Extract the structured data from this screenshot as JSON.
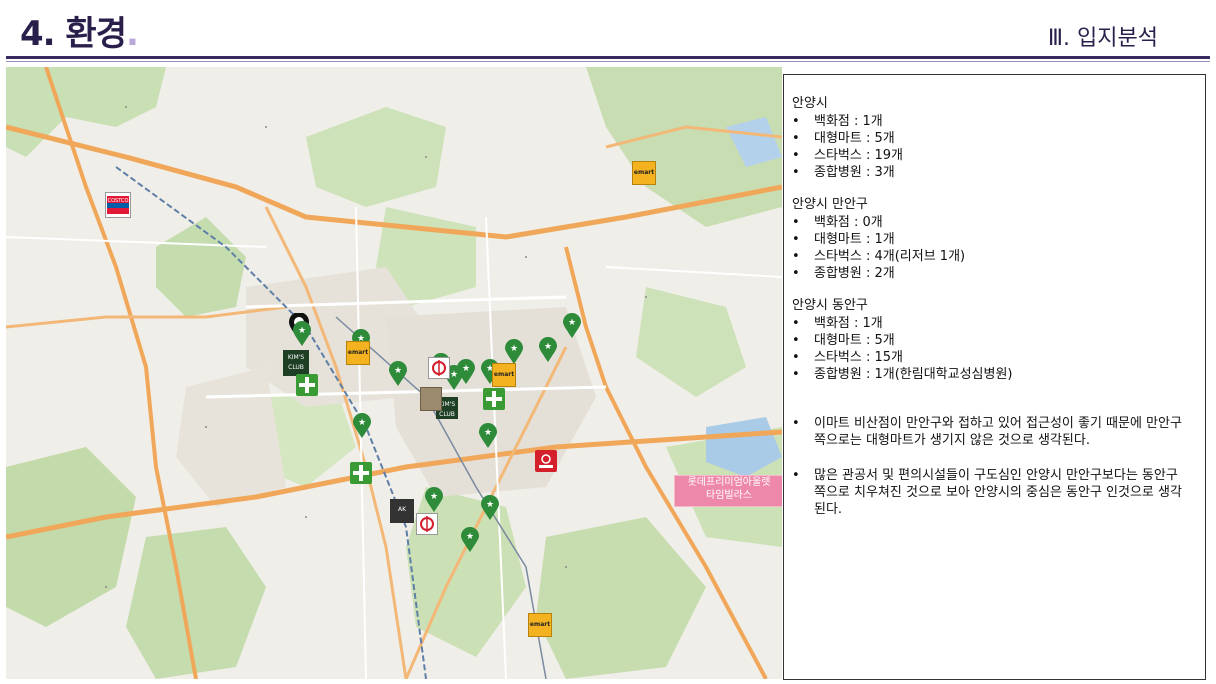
{
  "header": {
    "title": "4. 환경",
    "title_dot": ".",
    "section": "Ⅲ. 입지분석"
  },
  "map": {
    "callout": {
      "line1": "롯데프리미엄아울렛",
      "line2": "타임빌라스"
    },
    "brands": {
      "emart": "emart",
      "costco": "COSTCO",
      "kims": "KIM'S CLUB",
      "aks": "AK"
    },
    "icons": [
      "starbucks-pin-icon",
      "emart-logo-icon",
      "hospital-cross-icon",
      "homeplus-logo-icon",
      "lotte-mart-logo-icon",
      "costco-logo-icon",
      "kims-club-logo-icon",
      "ak-plaza-logo-icon"
    ],
    "colors": {
      "starbucks": "#2e8b3a",
      "hospital": "#3a9b35",
      "emart": "#f4b221",
      "lotte": "#d4202b",
      "callout": "#ee88aa"
    }
  },
  "panel": {
    "groups": [
      {
        "title": "안양시",
        "items": [
          "백화점 : 1개",
          "대형마트 : 5개",
          "스타벅스 : 19개",
          "종합병원 : 3개"
        ]
      },
      {
        "title": "안양시 만안구",
        "items": [
          "백화점 : 0개",
          "대형마트 : 1개",
          "스타벅스 : 4개(리저브 1개)",
          "종합병원 : 2개"
        ]
      },
      {
        "title": "안양시 동안구",
        "items": [
          "백화점 : 1개",
          "대형마트 : 5개",
          "스타벅스 : 15개",
          "종합병원 : 1개(한림대학교성심병원)"
        ]
      }
    ],
    "notes": [
      "이마트 비산점이 만안구와 접하고 있어 접근성이 좋기 때문에 만안구 쪽으로는 대형마트가 생기지 않은 것으로 생각된다.",
      "많은 관공서 및 편의시설들이 구도심인 안양시 만안구보다는 동안구 쪽으로 치우쳐진 것으로 보아 안양시의 중심은 동안구 인것으로 생각된다."
    ]
  }
}
